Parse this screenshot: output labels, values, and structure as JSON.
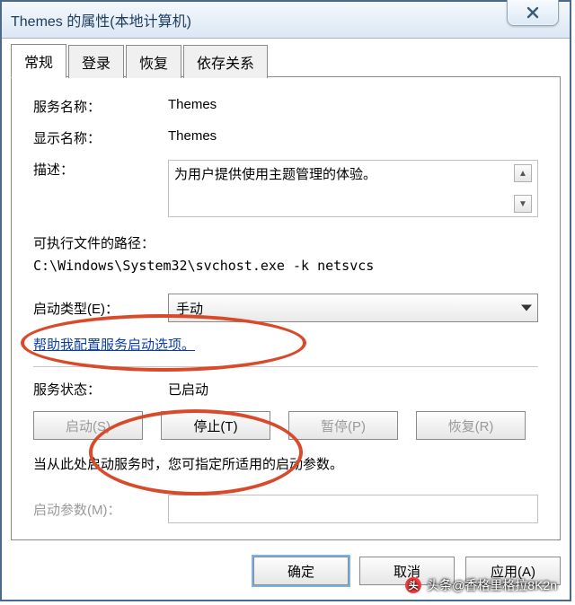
{
  "window": {
    "title": "Themes 的属性(本地计算机)"
  },
  "tabs": {
    "t0": "常规",
    "t1": "登录",
    "t2": "恢复",
    "t3": "依存关系"
  },
  "labels": {
    "service_name": "服务名称：",
    "display_name": "显示名称：",
    "description": "描述：",
    "exe_path_label": "可执行文件的路径：",
    "startup_type": "启动类型(E)：",
    "help_link": "帮助我配置服务启动选项。",
    "service_status": "服务状态：",
    "hint": "当从此处启动服务时，您可指定所适用的启动参数。",
    "start_params": "启动参数(M)："
  },
  "values": {
    "service_name": "Themes",
    "display_name": "Themes",
    "description": "为用户提供使用主题管理的体验。",
    "exe_path": "C:\\Windows\\System32\\svchost.exe -k netsvcs",
    "startup_type": "手动",
    "service_status": "已启动",
    "start_params": ""
  },
  "buttons": {
    "start": "启动(S)",
    "stop": "停止(T)",
    "pause": "暂停(P)",
    "resume": "恢复(R)",
    "ok": "确定",
    "cancel": "取消",
    "apply": "应用(A)"
  },
  "watermark": "头条@香格里格拉8K2n"
}
